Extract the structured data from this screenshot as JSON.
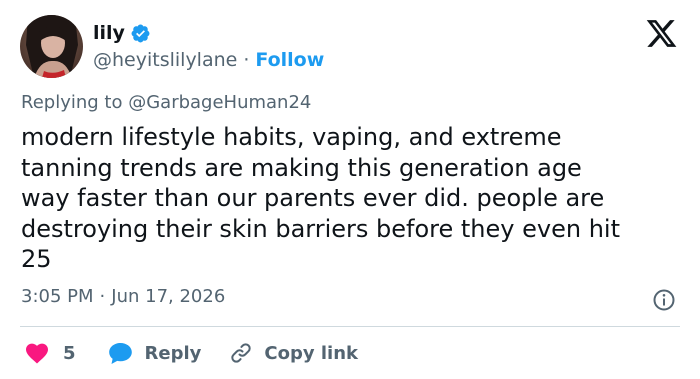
{
  "user": {
    "display_name": "lily",
    "handle": "@heyitslilylane",
    "separator": "·",
    "follow_label": "Follow",
    "avatar_icon": "profile-photo",
    "verified_icon": "verified-badge-icon",
    "verified_color": "#1d9bf0"
  },
  "brand": {
    "logo_icon": "x-logo-icon"
  },
  "tweet": {
    "replying_prefix": "Replying to",
    "replying_to": "@GarbageHuman24",
    "text": "modern lifestyle habits, vaping, and extreme\ntanning trends are making this generation age\nway faster than our parents ever did. people are\ndestroying their skin barriers before they even hit\n25",
    "time": "3:05 PM",
    "date_separator": "·",
    "date": "Jun 17, 2026"
  },
  "actions": {
    "like_count": "5",
    "like_icon": "heart-icon",
    "like_color": "#f91880",
    "reply_label": "Reply",
    "reply_icon": "speech-bubble-icon",
    "reply_color": "#1d9bf0",
    "copy_label": "Copy link",
    "copy_icon": "link-icon",
    "info_icon": "info-icon"
  },
  "colors": {
    "text_primary": "#0f1419",
    "text_secondary": "#536471",
    "accent": "#1d9bf0",
    "divider": "#cfd9de"
  }
}
